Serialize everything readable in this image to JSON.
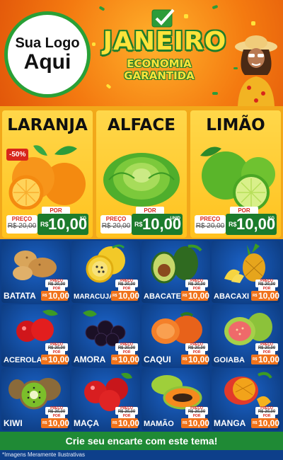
{
  "logo": {
    "line1": "Sua Logo",
    "line2": "Aqui"
  },
  "header": {
    "month": "JANEIRO",
    "sub1": "ECONOMIA",
    "sub2": "GARANTIDA"
  },
  "featured": [
    {
      "name": "LARANJA",
      "discount": "-50%",
      "old_label": "PREÇO",
      "old_price": "R$ 20,00",
      "por": "POR",
      "currency": "R$",
      "price": "10,00",
      "unit": "KG",
      "icon": "orange-image"
    },
    {
      "name": "ALFACE",
      "old_label": "PREÇO",
      "old_price": "R$ 20,00",
      "por": "POR",
      "currency": "R$",
      "price": "10,00",
      "unit": "UNID",
      "icon": "lettuce-image"
    },
    {
      "name": "LIMÃO",
      "old_label": "PREÇO",
      "old_price": "R$ 20,00",
      "por": "POR",
      "currency": "R$",
      "price": "10,00",
      "unit": "KG",
      "icon": "lime-image"
    }
  ],
  "grid": [
    {
      "name": "BATATA",
      "old_label": "PREÇO",
      "old_price": "R$ 20,00",
      "por": "POR",
      "currency": "R$",
      "price": "10,00"
    },
    {
      "name": "MARACUJÁ",
      "old_label": "PREÇO",
      "old_price": "R$ 20,00",
      "por": "POR",
      "currency": "R$",
      "price": "10,00"
    },
    {
      "name": "ABACATE",
      "old_label": "PREÇO",
      "old_price": "R$ 20,00",
      "por": "POR",
      "currency": "R$",
      "price": "10,00"
    },
    {
      "name": "ABACAXI",
      "old_label": "PREÇO",
      "old_price": "R$ 20,00",
      "por": "POR",
      "currency": "R$",
      "price": "10,00"
    },
    {
      "name": "ACEROLA",
      "old_label": "PREÇO",
      "old_price": "R$ 20,00",
      "por": "POR",
      "currency": "R$",
      "price": "10,00"
    },
    {
      "name": "AMORA",
      "old_label": "PREÇO",
      "old_price": "R$ 20,00",
      "por": "POR",
      "currency": "R$",
      "price": "10,00"
    },
    {
      "name": "CAQUI",
      "old_label": "PREÇO",
      "old_price": "R$ 20,00",
      "por": "POR",
      "currency": "R$",
      "price": "10,00"
    },
    {
      "name": "GOIABA",
      "old_label": "PREÇO",
      "old_price": "R$ 20,00",
      "por": "POR",
      "currency": "R$",
      "price": "10,00"
    },
    {
      "name": "KIWI",
      "old_label": "PREÇO",
      "old_price": "R$ 20,00",
      "por": "POR",
      "currency": "R$",
      "price": "10,00"
    },
    {
      "name": "MAÇA",
      "old_label": "PREÇO",
      "old_price": "R$ 20,00",
      "por": "POR",
      "currency": "R$",
      "price": "10,00"
    },
    {
      "name": "MAMÃO",
      "old_label": "PREÇO",
      "old_price": "R$ 20,00",
      "por": "POR",
      "currency": "R$",
      "price": "10,00"
    },
    {
      "name": "MANGA",
      "old_label": "PREÇO",
      "old_price": "R$ 20,00",
      "por": "POR",
      "currency": "R$",
      "price": "10,00"
    }
  ],
  "cta": "Crie seu encarte com este tema!",
  "note": "*Imagens Meramente Ilustrativas",
  "colors": {
    "header_orange": "#f47a10",
    "title_yellow": "#ffe33a",
    "green": "#1c7b2c",
    "grid_blue": "#0d3f8a",
    "price_orange": "#f0731b",
    "discount_red": "#d8261b"
  }
}
